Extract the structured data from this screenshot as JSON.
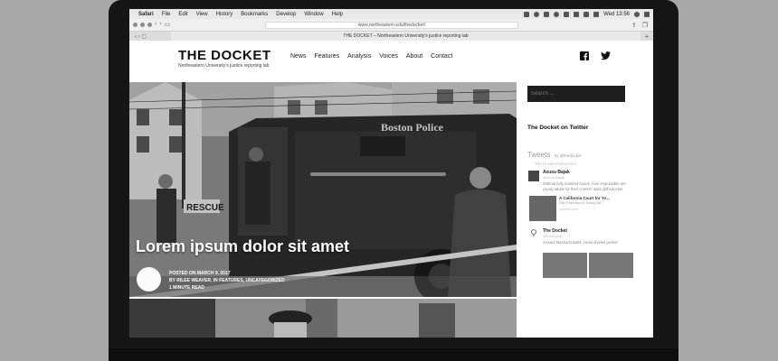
{
  "menubar": {
    "app": "Safari",
    "items": [
      "File",
      "Edit",
      "View",
      "History",
      "Bookmarks",
      "Develop",
      "Window",
      "Help"
    ],
    "clock": "Wed 13:56"
  },
  "browser": {
    "url": "www.northeastern.edu/thedocket/",
    "tab_title": "THE DOCKET – Northeastern University's justice reporting lab"
  },
  "site": {
    "logo": "THE DOCKET",
    "tagline": "Northeastern University's justice reporting lab",
    "nav": [
      "News",
      "Features",
      "Analysis",
      "Voices",
      "About",
      "Contact"
    ],
    "social": [
      "facebook-icon",
      "twitter-icon"
    ]
  },
  "hero": {
    "title": "Lorem ipsum dolor sit amet",
    "meta_line1": "POSTED ON MARCH 9, 2017",
    "meta_line2": "BY RILEE WEAVER, IN FEATURES, UNCATEGORIZED",
    "meta_line3": "1 MINUTE READ",
    "vehicle_text": "Boston Police",
    "vehicle_side": "RESCUE"
  },
  "sidebar": {
    "search_placeholder": "Search ...",
    "twitter_heading": "The Docket on Twitter",
    "tweets_label": "Tweets",
    "tweets_by": "by @thedocket",
    "retweeted": "The Docket Retweeted",
    "tweet1_name": "Azusu Bajak",
    "tweet1_handle": "@azusubajak",
    "tweet1_text": "Without fully matured brains, how responsible are young adults for their crimes? asks @thedocket",
    "card_title": "A California Court for Yo...",
    "card_desc": "San Francisco's Young Ad...",
    "card_site": "nytimes.com",
    "tweet2_name": "The Docket",
    "tweet2_handle": "@thedocket",
    "tweet2_text": "Around Massachusetts, racial divides persist"
  }
}
